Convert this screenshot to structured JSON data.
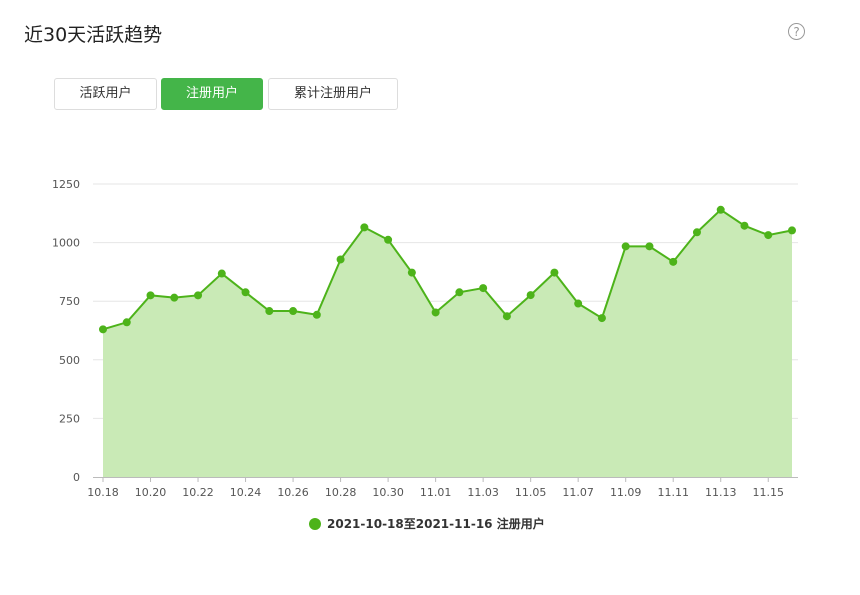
{
  "page": {
    "title": "近30天活跃趋势",
    "help_icon": "question-circle-icon",
    "help_glyph": "?"
  },
  "tabs": [
    {
      "label": "活跃用户",
      "active": false
    },
    {
      "label": "注册用户",
      "active": true
    },
    {
      "label": "累计注册用户",
      "active": false
    }
  ],
  "colors": {
    "accent": "#44b549",
    "series_line": "#4db31a",
    "series_fill": "#c9eab6",
    "grid": "#e6e6e6"
  },
  "chart_data": {
    "type": "area",
    "grid": true,
    "legend_position": "bottom-center",
    "ylim": [
      0,
      1250
    ],
    "yticks": [
      0,
      250,
      500,
      750,
      1000,
      1250
    ],
    "x": [
      "10.18",
      "10.19",
      "10.20",
      "10.21",
      "10.22",
      "10.23",
      "10.24",
      "10.25",
      "10.26",
      "10.27",
      "10.28",
      "10.29",
      "10.30",
      "10.31",
      "11.01",
      "11.02",
      "11.03",
      "11.04",
      "11.05",
      "11.06",
      "11.07",
      "11.08",
      "11.09",
      "11.10",
      "11.11",
      "11.12",
      "11.13",
      "11.14",
      "11.15",
      "11.16"
    ],
    "xtick_labels": [
      "10.18",
      "10.20",
      "10.22",
      "10.24",
      "10.26",
      "10.28",
      "10.30",
      "11.01",
      "11.03",
      "11.05",
      "11.07",
      "11.09",
      "11.11",
      "11.13",
      "11.15"
    ],
    "series": [
      {
        "name": "2021-10-18至2021-11-16 注册用户",
        "values": [
          630,
          660,
          775,
          765,
          775,
          868,
          788,
          708,
          708,
          692,
          928,
          1065,
          1012,
          872,
          702,
          788,
          806,
          686,
          776,
          872,
          740,
          678,
          984,
          984,
          918,
          1044,
          1140,
          1072,
          1032,
          1052
        ]
      }
    ]
  }
}
